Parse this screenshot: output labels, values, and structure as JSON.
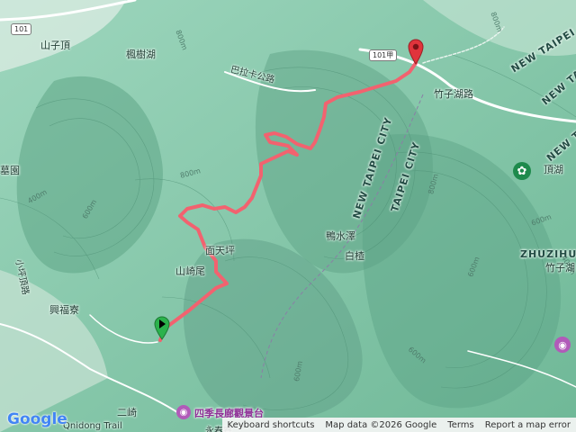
{
  "map": {
    "places": {
      "shanzi_ding": "山子頂",
      "fengshu_hu": "楓樹湖",
      "balaka_road": "巴拉卡公路",
      "zhuzihu_road": "竹子湖路",
      "dinghu": "頂湖",
      "new_taipei_1": "NEW TAIPEI CITY",
      "new_taipei_2": "NEW TAIPEI CITY",
      "new_taipei_3": "NEW TAIPEI C",
      "new_taipei_4": "NEW TAIPEI CITY",
      "taipei_city": "TAIPEI CITY",
      "yashuize": "鴨水澤",
      "baiqun": "白楂",
      "miantianping": "面天坪",
      "shanqiwei": "山崎尾",
      "xingfuliao": "興福寮",
      "erqi": "二崎",
      "yongchunliao": "永春寮",
      "zhuzihu_en": "ZHUZIHU",
      "zhuzihu_cn": "竹子湖",
      "garden_fragment": "墓園",
      "road_fragment": "小坪頂路",
      "trail_fragment": "Qnidong Trail"
    },
    "roads": {
      "route_101": "101",
      "route_101a": "101甲"
    },
    "poi": {
      "scenic_label": "四季長廊觀景台",
      "scenic_icon": "camera-icon",
      "park_icon": "flower-icon",
      "right_icon": "camera-icon"
    },
    "elevations": [
      "800m",
      "600m",
      "400m",
      "800m",
      "600m",
      "800m",
      "600m",
      "400m",
      "600m",
      "600m",
      "800m"
    ],
    "markers": {
      "start_color": "#2bb24c",
      "end_color": "#e0343c"
    },
    "route_color": "#f2626f",
    "footer": {
      "keyboard": "Keyboard shortcuts",
      "mapdata": "Map data ©2026 Google",
      "terms": "Terms",
      "report": "Report a map error"
    },
    "brand": "Google"
  }
}
